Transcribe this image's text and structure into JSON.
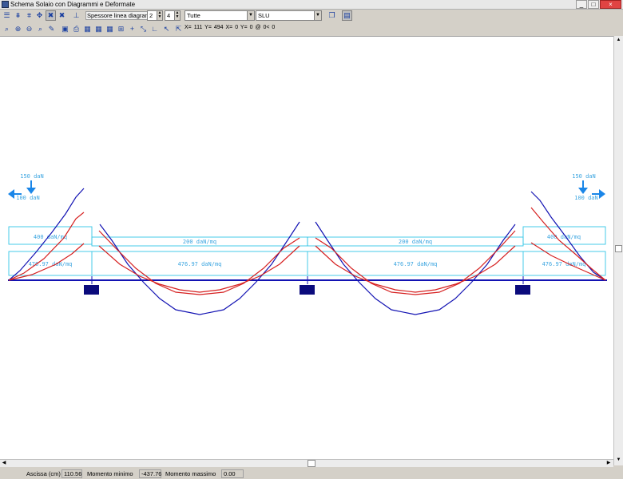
{
  "window": {
    "title": "Schema Solaio con Diagrammi e Deformate",
    "minimize": "_",
    "maximize": "□",
    "close": "×"
  },
  "toolbar1": {
    "line_thickness_label": "Spessore linea diagrammi",
    "spin1_value": "2",
    "spin2_value": "4",
    "combo1_value": "Tutte",
    "combo2_value": "SLU"
  },
  "toolbar2": {
    "coords_text": "X= 111 Y= 494 X= 0 Y= 0 @ 0< 0"
  },
  "drawing": {
    "load_left_vertical": "150 daN",
    "load_left_horizontal": "100 daN",
    "load_right_vertical": "150 daN",
    "load_right_horizontal": "100 daN",
    "band_upper": [
      "400 daN/mq",
      "200 daN/mq",
      "200 daN/mq",
      "400 daN/mq"
    ],
    "band_lower": [
      "476.97 daN/mq",
      "476.97 daN/mq",
      "476.97 daN/mq",
      "476.97 daN/mq"
    ],
    "colors": {
      "cyan": "#33c6e6",
      "blue": "#1313b3",
      "red": "#d62020",
      "support": "#0b0b7c",
      "arrow": "#1a86e8",
      "text": "#3ba5e0"
    }
  },
  "statusbar": {
    "abscissa_label": "Ascissa (cm)",
    "abscissa_value": "110.56",
    "min_moment_label": "Momento minimo",
    "min_moment_value": "-437.76",
    "max_moment_label": "Momento massimo",
    "max_moment_value": "0.00"
  }
}
